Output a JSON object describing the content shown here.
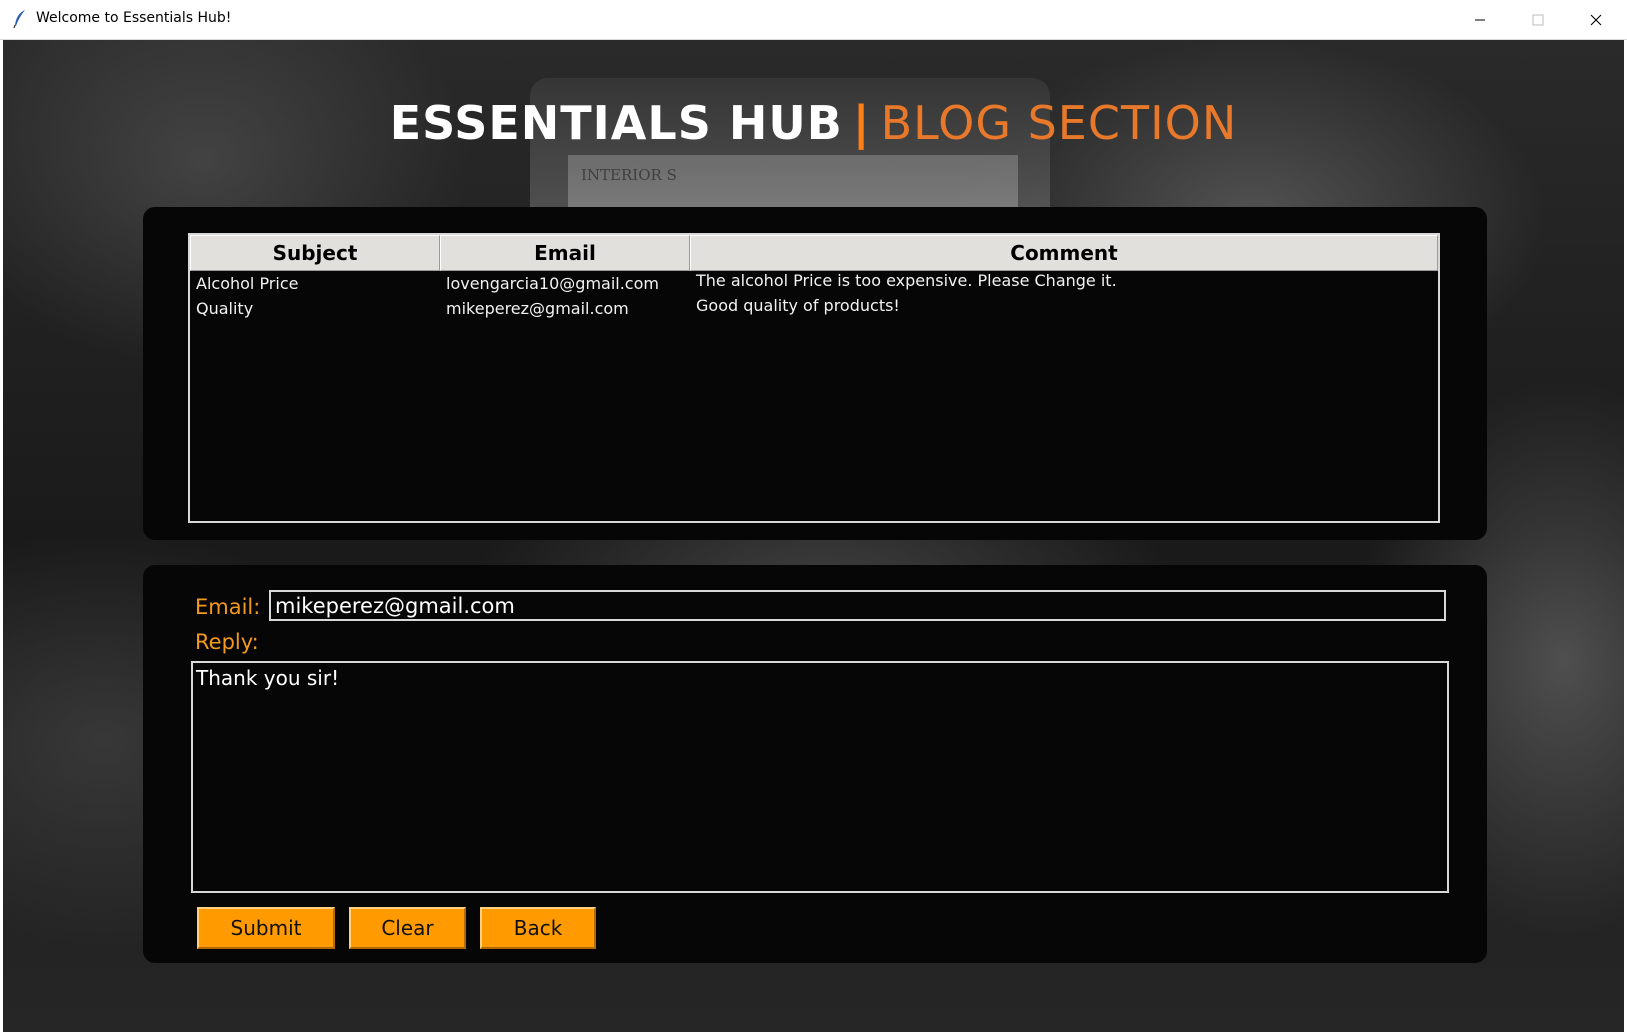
{
  "window": {
    "title": "Welcome to Essentials Hub!",
    "controls": [
      "minimize-icon",
      "maximize-icon",
      "close-icon"
    ]
  },
  "background": {
    "laptop_text": "INTERIOR S"
  },
  "heading": {
    "main": "ESSENTIALS HUB",
    "separator": "|",
    "sub": "BLOG SECTION",
    "colors": {
      "main": "#ffffff",
      "accent": "#e8782a"
    }
  },
  "table": {
    "columns": [
      "Subject",
      "Email",
      "Comment"
    ],
    "rows": [
      {
        "subject": "Alcohol Price",
        "email": "lovengarcia10@gmail.com",
        "comment": "The alcohol Price is too expensive. Please Change it."
      },
      {
        "subject": "Quality",
        "email": "mikeperez@gmail.com",
        "comment": "Good quality of products!"
      }
    ]
  },
  "form": {
    "email_label": "Email:",
    "email_value": "mikeperez@gmail.com",
    "reply_label": "Reply:",
    "reply_value": "Thank you sir!",
    "label_color": "#f39a1e"
  },
  "buttons": {
    "submit": "Submit",
    "clear": "Clear",
    "back": "Back",
    "color": "#ff9a00"
  }
}
